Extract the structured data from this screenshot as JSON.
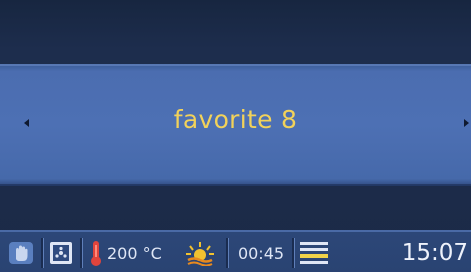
{
  "display": {
    "program_name": "favorite 8"
  },
  "statusbar": {
    "icons": [
      "hand-icon",
      "cooking-mode-icon",
      "thermometer-icon",
      "heating-sun-icon",
      "rack-level-icon"
    ],
    "temperature": "200 °C",
    "duration": "00:45",
    "clock": "15:07"
  },
  "colors": {
    "title": "#f2d25a",
    "band": "#4d70b4",
    "background": "#1b2a47",
    "statusbar": "#2c4778",
    "thermometer": "#e0443c",
    "sun": "#f2c230",
    "rack": "#f0d24a"
  }
}
